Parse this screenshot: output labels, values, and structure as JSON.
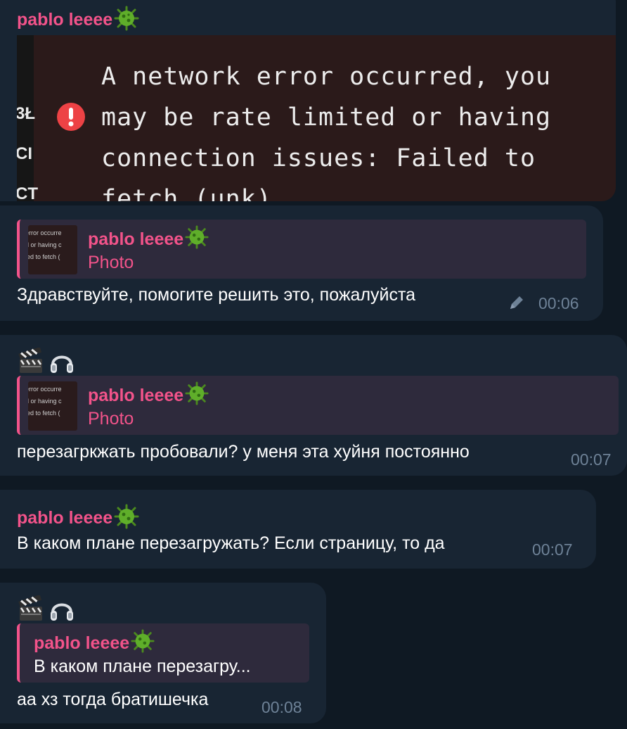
{
  "messages": {
    "m1": {
      "sender": "pablo leeee",
      "sender_emoji": "virus-icon",
      "photo": {
        "error_text": "A network error occurred, you may be rate limited or having connection issues: Failed to fetch (unk)",
        "side_fragments": [
          "3Ł",
          "CI",
          "CT"
        ]
      }
    },
    "m2": {
      "reply": {
        "name": "pablo leeee",
        "sub": "Photo",
        "thumb_lines": [
          "error occurre",
          "d or having c",
          "led to fetch ("
        ]
      },
      "text": "Здравствуйте, помогите решить это, пожалуйста",
      "time": "00:06",
      "edited_icon": "pencil-icon"
    },
    "m3": {
      "emojis": [
        "clapperboard-icon",
        "headphones-icon"
      ],
      "reply": {
        "name": "pablo leeee",
        "sub": "Photo",
        "thumb_lines": [
          "error occurre",
          "d or having c",
          "led to fetch ("
        ]
      },
      "text": "перезагркжать пробовали? у меня эта хуйня постоянно",
      "time": "00:07"
    },
    "m4": {
      "sender": "pablo leeee",
      "text": "В каком плане перезагружать? Если страницу, то да",
      "time": "00:07"
    },
    "m5": {
      "emojis": [
        "clapperboard-icon",
        "headphones-icon"
      ],
      "reply": {
        "name": "pablo leeee",
        "sub": "В каком плане перезагру..."
      },
      "text": "аа хз тогда братишечка",
      "time": "00:08"
    }
  },
  "colors": {
    "background": "#0f1923",
    "bubble": "#182533",
    "accent": "#f2538a",
    "time": "#6e8297",
    "reply_bg": "#2e2a3c"
  }
}
